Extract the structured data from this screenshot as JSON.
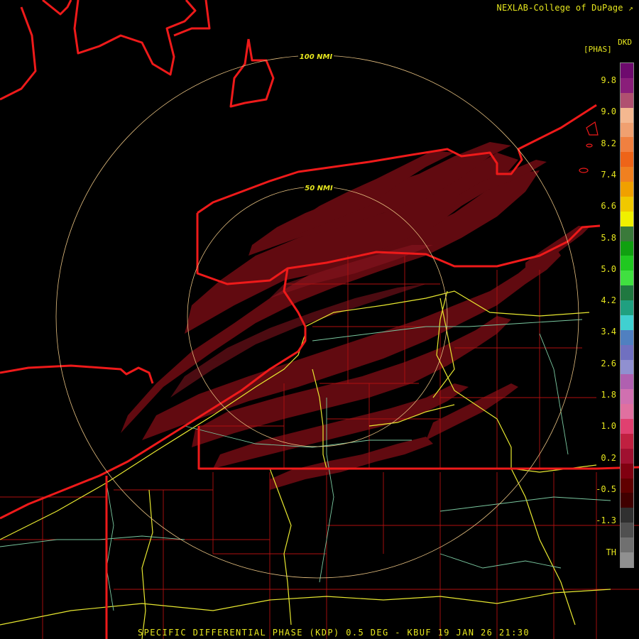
{
  "credit": "NEXLAB-College of DuPage",
  "credit_icon": "external-link-icon",
  "product": "DKD",
  "unit": "[PHAS]",
  "caption": "SPECIFIC DIFFERENTIAL PHASE (KDP) 0.5 DEG - KBUF 19 JAN 26 21:30",
  "range_rings": {
    "inner_label": "50 NMI",
    "outer_label": "100 NMI"
  },
  "colorbar": {
    "labels": [
      "9.8",
      "9.0",
      "8.2",
      "7.4",
      "6.6",
      "5.8",
      "5.0",
      "4.2",
      "3.4",
      "2.6",
      "1.8",
      "1.0",
      "0.2",
      "-0.5",
      "-1.3",
      "TH"
    ],
    "colors": [
      "#6e0a6e",
      "#8a1e7a",
      "#b05070",
      "#f4b890",
      "#f0a070",
      "#f08040",
      "#ee6418",
      "#f08020",
      "#f0a000",
      "#f0c800",
      "#f0f000",
      "#3a7a3a",
      "#10a010",
      "#20c820",
      "#40e040",
      "#207840",
      "#20a080",
      "#40d0d0",
      "#5080c0",
      "#7070c0",
      "#9090d0",
      "#b060b0",
      "#d070b0",
      "#e070a0",
      "#e04070",
      "#c02040",
      "#a01030",
      "#800010",
      "#600000",
      "#400000",
      "#303030",
      "#505050",
      "#707070",
      "#909090"
    ]
  }
}
